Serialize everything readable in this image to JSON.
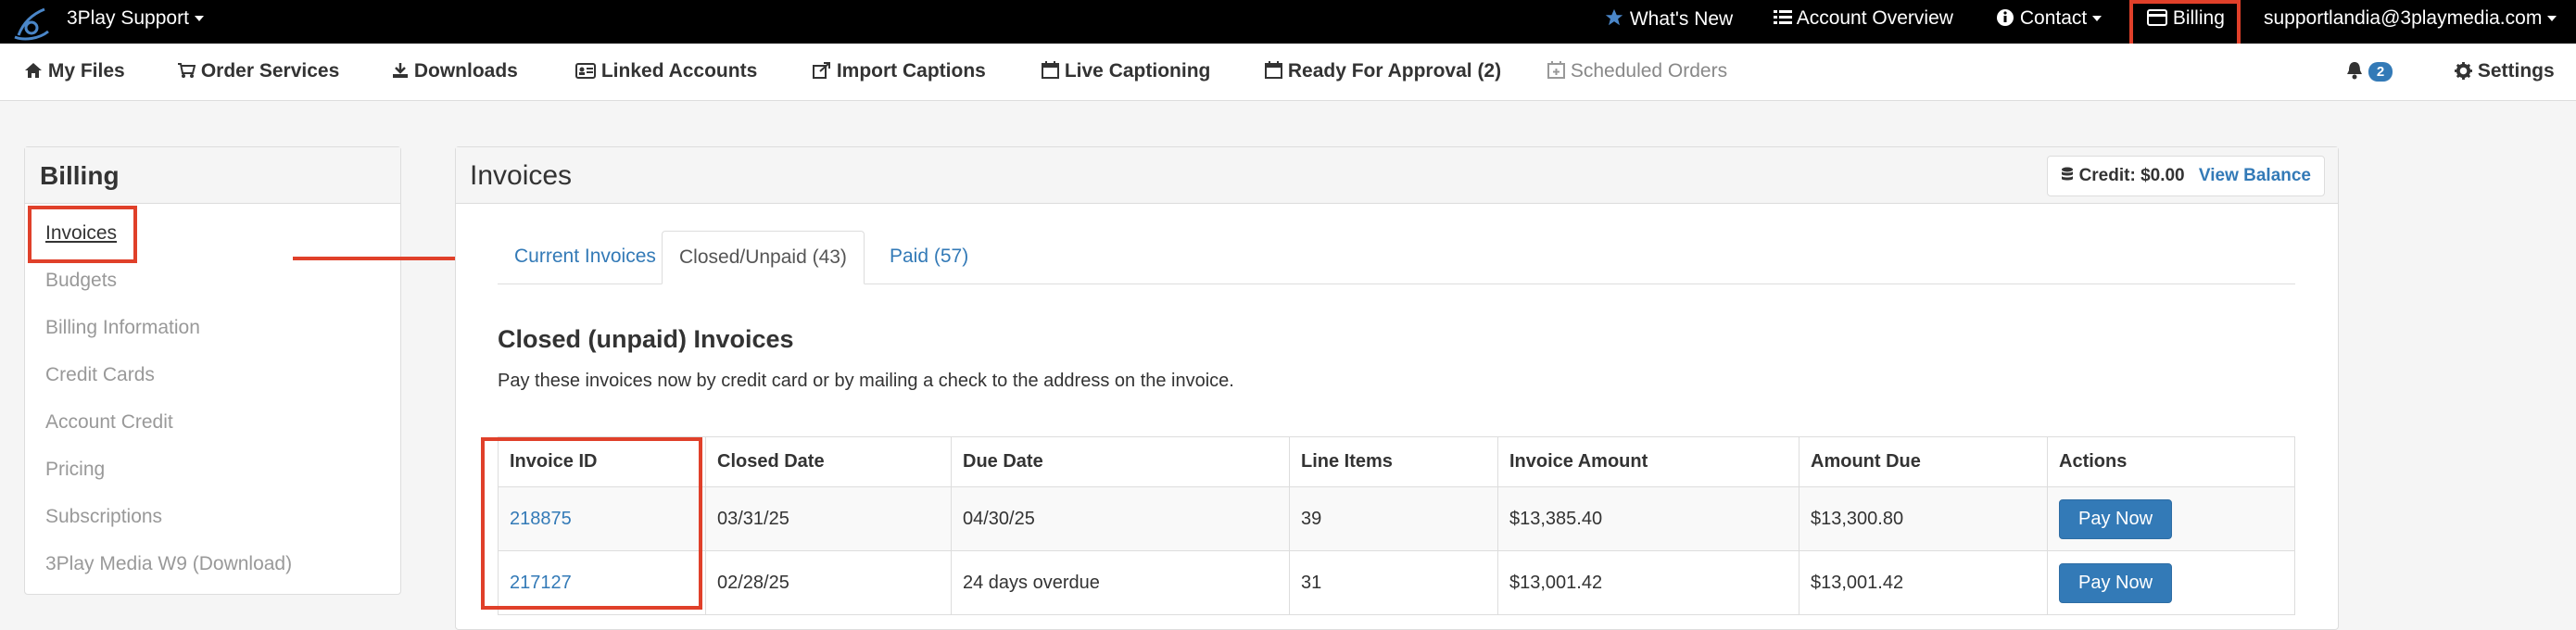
{
  "topbar": {
    "brand": "3Play Support",
    "whats_new": "What's New",
    "account_overview": "Account Overview",
    "contact": "Contact",
    "billing": "Billing",
    "user_email": "supportlandia@3playmedia.com"
  },
  "subnav": {
    "my_files": "My Files",
    "order_services": "Order Services",
    "downloads": "Downloads",
    "linked_accounts": "Linked Accounts",
    "import_captions": "Import Captions",
    "live_captioning": "Live Captioning",
    "ready_for_approval": "Ready For Approval (2)",
    "scheduled_orders": "Scheduled Orders",
    "notification_count": "2",
    "settings": "Settings"
  },
  "sidebar": {
    "title": "Billing",
    "items": [
      {
        "label": "Invoices"
      },
      {
        "label": "Budgets"
      },
      {
        "label": "Billing Information"
      },
      {
        "label": "Credit Cards"
      },
      {
        "label": "Account Credit"
      },
      {
        "label": "Pricing"
      },
      {
        "label": "Subscriptions"
      },
      {
        "label": "3Play Media W9 (Download)"
      }
    ]
  },
  "main": {
    "title": "Invoices",
    "credit_label": "Credit: $0.00",
    "view_balance": "View Balance",
    "tabs": [
      {
        "label": "Current Invoices"
      },
      {
        "label": "Closed/Unpaid (43)"
      },
      {
        "label": "Paid (57)"
      }
    ],
    "section_title": "Closed (unpaid) Invoices",
    "section_desc": "Pay these invoices now by credit card or by mailing a check to the address on the invoice."
  },
  "table": {
    "headers": [
      "Invoice ID",
      "Closed Date",
      "Due Date",
      "Line Items",
      "Invoice Amount",
      "Amount Due",
      "Actions"
    ],
    "rows": [
      {
        "id": "218875",
        "closed": "03/31/25",
        "due": "04/30/25",
        "items": "39",
        "amount": "$13,385.40",
        "due_amount": "$13,300.80",
        "action": "Pay Now"
      },
      {
        "id": "217127",
        "closed": "02/28/25",
        "due": "24 days overdue",
        "items": "31",
        "amount": "$13,001.42",
        "due_amount": "$13,001.42",
        "action": "Pay Now"
      }
    ]
  },
  "colors": {
    "link": "#337ab7",
    "highlight": "#e0402a",
    "topbar": "#000000"
  },
  "icons": [
    "logo-icon",
    "star-icon",
    "list-icon",
    "info-icon",
    "credit-card-icon",
    "home-icon",
    "cart-icon",
    "download-icon",
    "id-card-icon",
    "external-link-icon",
    "calendar-icon",
    "calendar-plus-icon",
    "bell-icon",
    "gear-icon",
    "database-icon"
  ]
}
